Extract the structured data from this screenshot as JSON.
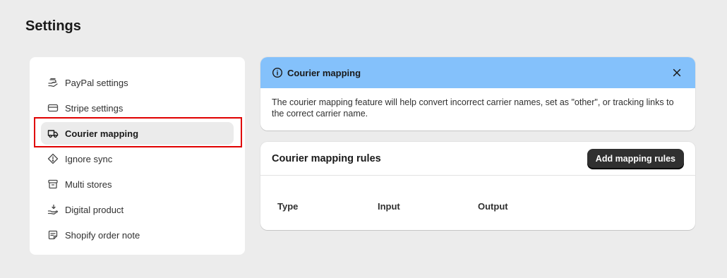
{
  "page": {
    "title": "Settings"
  },
  "sidebar": {
    "items": [
      {
        "label": "PayPal settings",
        "icon": "paypal-hand-icon"
      },
      {
        "label": "Stripe settings",
        "icon": "credit-card-icon"
      },
      {
        "label": "Courier mapping",
        "icon": "delivery-truck-icon",
        "active": true
      },
      {
        "label": "Ignore sync",
        "icon": "alert-diamond-icon"
      },
      {
        "label": "Multi stores",
        "icon": "archive-box-icon"
      },
      {
        "label": "Digital product",
        "icon": "download-hand-icon"
      },
      {
        "label": "Shopify order note",
        "icon": "note-icon"
      }
    ]
  },
  "banner": {
    "title": "Courier mapping",
    "body": "The courier mapping feature will help convert incorrect carrier names, set as \"other\", or tracking links to the correct carrier name.",
    "color": "#84c1fb"
  },
  "rules": {
    "title": "Courier mapping rules",
    "add_label": "Add mapping rules",
    "columns": [
      "Type",
      "Input",
      "Output"
    ]
  },
  "colors": {
    "highlight": "#e00000",
    "primary_button": "#303030"
  }
}
